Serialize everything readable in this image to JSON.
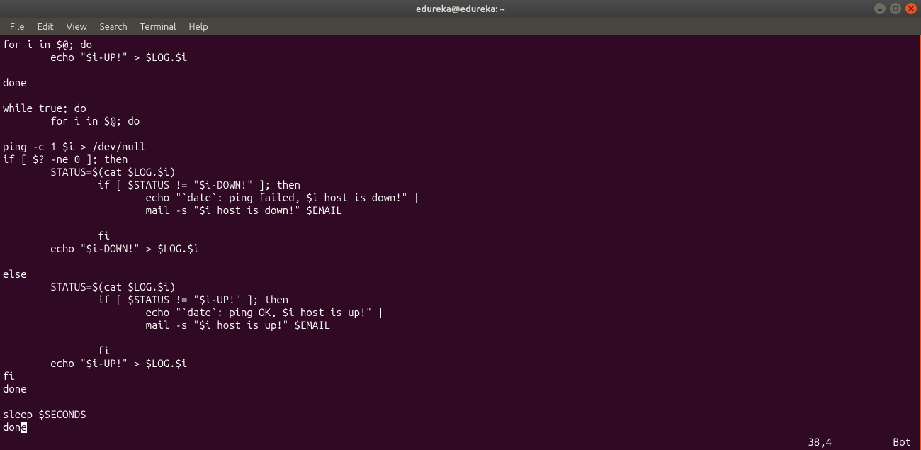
{
  "window": {
    "title": "edureka@edureka: ~"
  },
  "menu": {
    "file": "File",
    "edit": "Edit",
    "view": "View",
    "search": "Search",
    "terminal": "Terminal",
    "help": "Help"
  },
  "lines": {
    "l0": "for i in $@; do",
    "l1": "        echo \"$i-UP!\" > $LOG.$i",
    "l2": "",
    "l3": "done",
    "l4": "",
    "l5": "while true; do",
    "l6": "        for i in $@; do",
    "l7": "",
    "l8": "ping -c 1 $i > /dev/null",
    "l9": "if [ $? -ne 0 ]; then",
    "l10": "        STATUS=$(cat $LOG.$i)",
    "l11": "                if [ $STATUS != \"$i-DOWN!\" ]; then",
    "l12": "                        echo \"`date`: ping failed, $i host is down!\" |",
    "l13": "                        mail -s \"$i host is down!\" $EMAIL",
    "l14": "",
    "l15": "                fi",
    "l16": "        echo \"$i-DOWN!\" > $LOG.$i",
    "l17": "",
    "l18": "else",
    "l19": "        STATUS=$(cat $LOG.$i)",
    "l20": "                if [ $STATUS != \"$i-UP!\" ]; then",
    "l21": "                        echo \"`date`: ping OK, $i host is up!\" |",
    "l22": "                        mail -s \"$i host is up!\" $EMAIL",
    "l23": "",
    "l24": "                fi",
    "l25": "        echo \"$i-UP!\" > $LOG.$i",
    "l26": "fi",
    "l27": "done",
    "l28": "",
    "l29": "sleep $SECONDS",
    "l30a": "don",
    "l30b": "e"
  },
  "status": {
    "position": "38,4",
    "scroll": "Bot"
  }
}
